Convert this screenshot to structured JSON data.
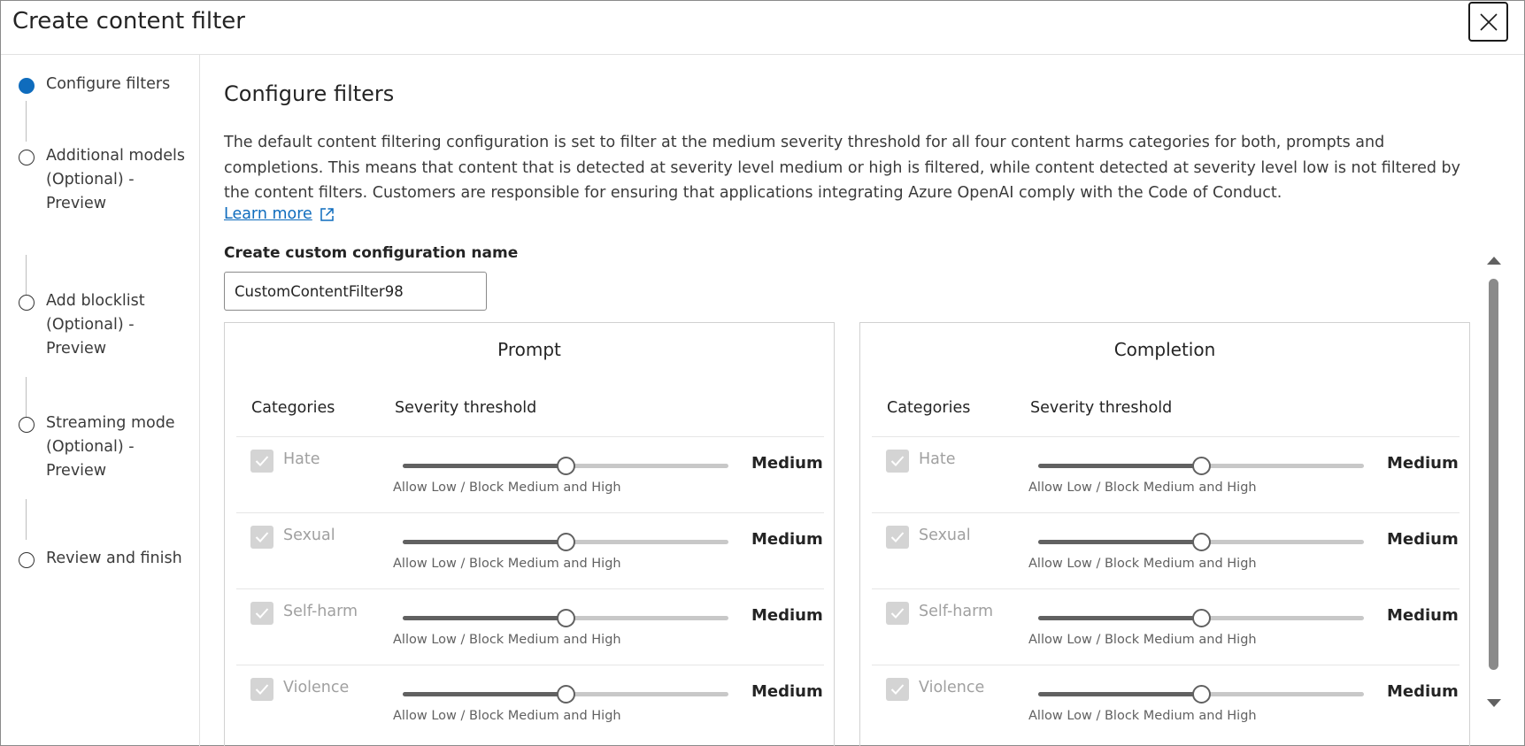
{
  "dialog": {
    "title": "Create content filter",
    "close_label": "Close"
  },
  "sidebar": {
    "steps": [
      {
        "label": "Configure filters",
        "active": true
      },
      {
        "label": "Additional models (Optional) - Preview",
        "active": false
      },
      {
        "label": "Add blocklist (Optional) - Preview",
        "active": false
      },
      {
        "label": "Streaming mode (Optional) - Preview",
        "active": false
      },
      {
        "label": "Review and finish",
        "active": false
      }
    ]
  },
  "main": {
    "section_title": "Configure filters",
    "description": "The default content filtering configuration is set to filter at the medium severity threshold for all four content harms categories for both, prompts and completions. This means that content that is detected at severity level medium or high is filtered, while content detected at severity level low is not filtered by the content filters. Customers are responsible for ensuring that applications integrating Azure OpenAI comply with the Code of Conduct.",
    "learn_more": "Learn more",
    "config_name_label": "Create custom configuration name",
    "config_name_value": "CustomContentFilter98"
  },
  "panels": [
    {
      "title": "Prompt",
      "categories_header": "Categories",
      "threshold_header": "Severity threshold",
      "rows": [
        {
          "category": "Hate",
          "value": "Medium",
          "hint": "Allow Low / Block Medium and High",
          "level": 0.5,
          "checked": true
        },
        {
          "category": "Sexual",
          "value": "Medium",
          "hint": "Allow Low / Block Medium and High",
          "level": 0.5,
          "checked": true
        },
        {
          "category": "Self-harm",
          "value": "Medium",
          "hint": "Allow Low / Block Medium and High",
          "level": 0.5,
          "checked": true
        },
        {
          "category": "Violence",
          "value": "Medium",
          "hint": "Allow Low / Block Medium and High",
          "level": 0.5,
          "checked": true
        }
      ]
    },
    {
      "title": "Completion",
      "categories_header": "Categories",
      "threshold_header": "Severity threshold",
      "rows": [
        {
          "category": "Hate",
          "value": "Medium",
          "hint": "Allow Low / Block Medium and High",
          "level": 0.5,
          "checked": true
        },
        {
          "category": "Sexual",
          "value": "Medium",
          "hint": "Allow Low / Block Medium and High",
          "level": 0.5,
          "checked": true
        },
        {
          "category": "Self-harm",
          "value": "Medium",
          "hint": "Allow Low / Block Medium and High",
          "level": 0.5,
          "checked": true
        },
        {
          "category": "Violence",
          "value": "Medium",
          "hint": "Allow Low / Block Medium and High",
          "level": 0.5,
          "checked": true
        }
      ]
    }
  ],
  "colors": {
    "accent": "#0f6cbd",
    "slider_fill": "#616161",
    "slider_track": "#c8c8c8",
    "disabled_text": "#a0a0a0"
  }
}
